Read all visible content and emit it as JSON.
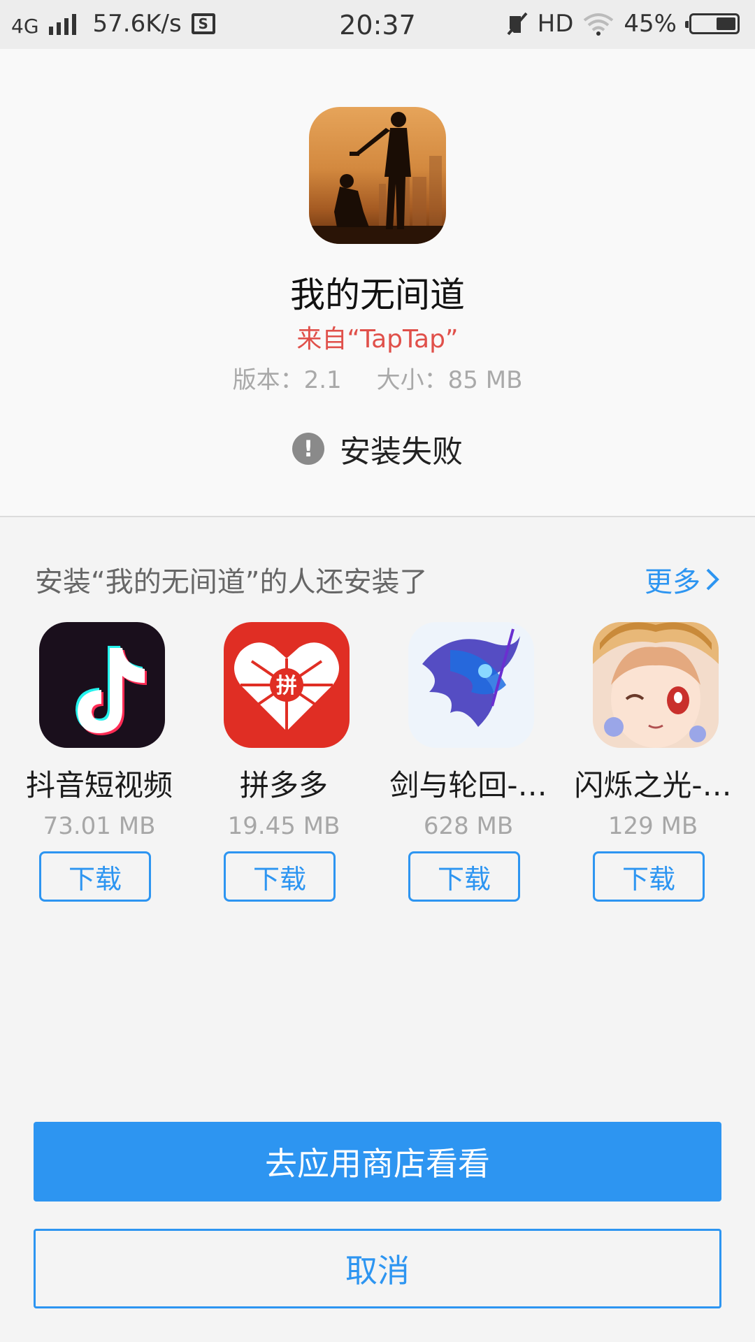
{
  "status_bar": {
    "network": "4G",
    "speed": "57.6K/s",
    "screenshot_icon_glyph": "S",
    "time": "20:37",
    "hd": "HD",
    "battery": "45%",
    "battery_level": 0.45
  },
  "app": {
    "name": "我的无间道",
    "source": "来自“TapTap”",
    "version": "版本：2.1",
    "size": "大小：85 MB",
    "install_status_icon": "!",
    "install_status": "安装失败"
  },
  "recommend": {
    "title": "安装“我的无间道”的人还安装了",
    "more": "更多",
    "apps": [
      {
        "name": "抖音短视频",
        "size": "73.01 MB",
        "button": "下载",
        "icon": "tiktok-icon"
      },
      {
        "name": "拼多多",
        "size": "19.45 MB",
        "button": "下载",
        "icon": "pinduoduo-icon"
      },
      {
        "name": "剑与轮回-…",
        "size": "628 MB",
        "button": "下载",
        "icon": "sword-game-icon"
      },
      {
        "name": "闪烁之光-…",
        "size": "129 MB",
        "button": "下载",
        "icon": "anime-girl-icon"
      }
    ]
  },
  "buttons": {
    "store": "去应用商店看看",
    "cancel": "取消"
  },
  "colors": {
    "accent": "#2d95f1",
    "source_red": "#e0504a",
    "status_bar_bg": "#ededed",
    "panel_bg": "#f9f9f9",
    "page_bg": "#f4f4f4"
  }
}
